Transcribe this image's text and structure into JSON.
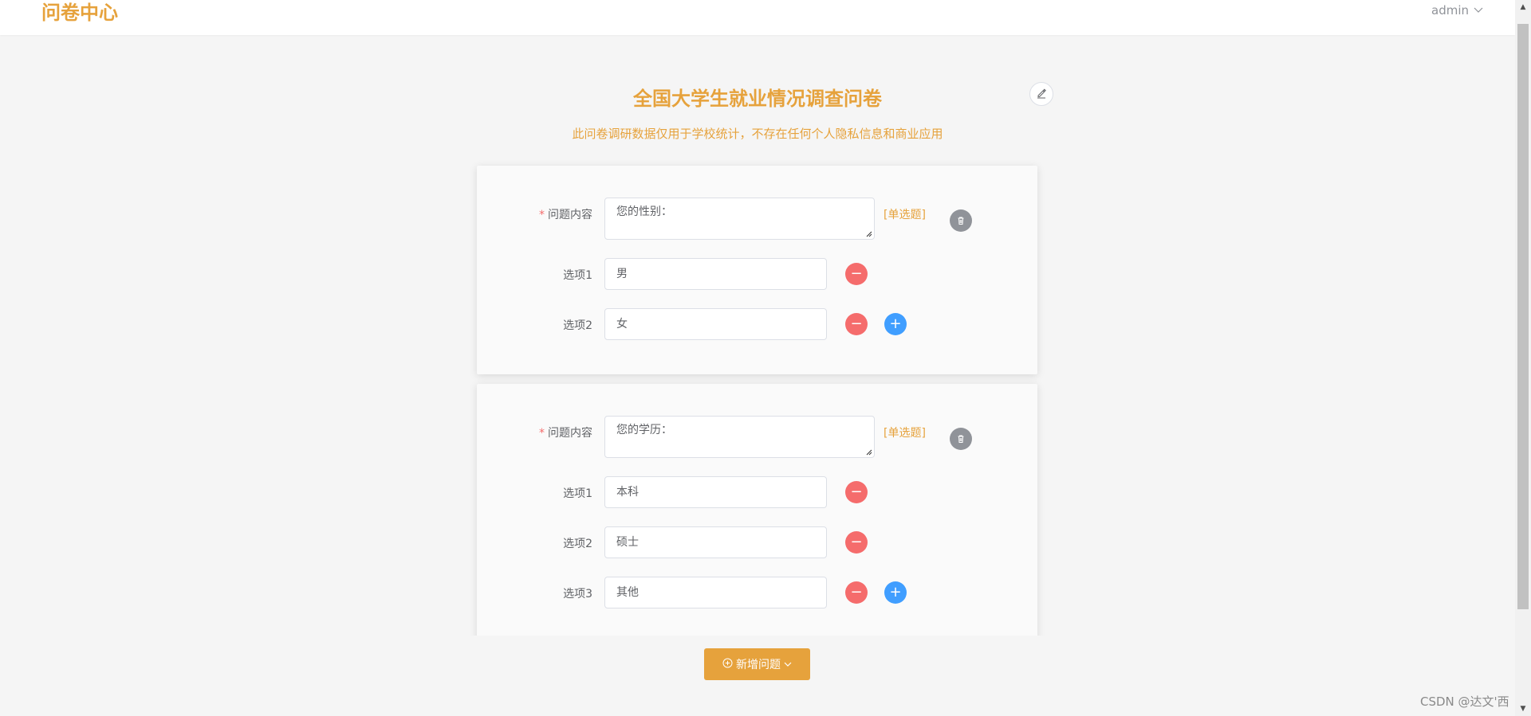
{
  "header": {
    "logo": "问卷中心",
    "user": "admin"
  },
  "survey": {
    "title": "全国大学生就业情况调查问卷",
    "subtitle": "此问卷调研数据仅用于学校统计，不存在任何个人隐私信息和商业应用"
  },
  "labels": {
    "question": "问题内容",
    "required_mark": "*"
  },
  "questions": [
    {
      "content": "您的性别：",
      "type": "[单选题]",
      "options": [
        {
          "label": "选项1",
          "value": "男"
        },
        {
          "label": "选项2",
          "value": "女"
        }
      ]
    },
    {
      "content": "您的学历：",
      "type": "[单选题]",
      "options": [
        {
          "label": "选项1",
          "value": "本科"
        },
        {
          "label": "选项2",
          "value": "硕士"
        },
        {
          "label": "选项3",
          "value": "其他"
        }
      ]
    }
  ],
  "actions": {
    "add_question": "新增问题"
  },
  "watermark": "CSDN @达文'西",
  "colors": {
    "accent": "#e6a23c",
    "danger": "#f56c6c",
    "primary": "#409eff",
    "info": "#909399"
  }
}
